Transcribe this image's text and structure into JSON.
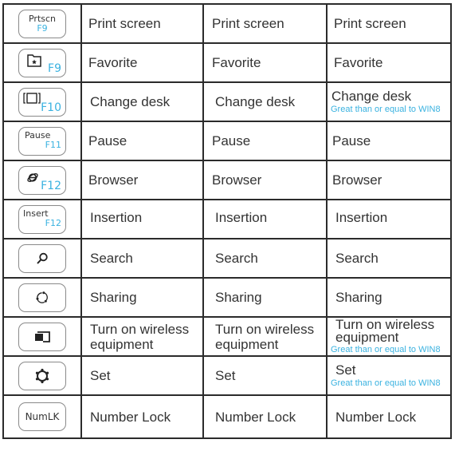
{
  "colors": {
    "border": "#2b2b2b",
    "text": "#333333",
    "fn_blue": "#3ab2e0",
    "note_blue": "#3ab2e0"
  },
  "rows": [
    {
      "key": {
        "top": "Prtscn",
        "fn": "F9",
        "icon": "none"
      },
      "col1": "Print screen",
      "col2": "Print screen",
      "col3": "Print screen",
      "col3_note": ""
    },
    {
      "key": {
        "top": "",
        "fn": "F9",
        "icon": "favorite-folder-star-icon"
      },
      "col1": "Favorite",
      "col2": "Favorite",
      "col3": "Favorite",
      "col3_note": ""
    },
    {
      "key": {
        "top": "",
        "fn": "F10",
        "icon": "change-desk-window-icon"
      },
      "col1": "Change desk",
      "col2": "Change desk",
      "col3": "Change desk",
      "col3_note": "Great than or equal to WIN8"
    },
    {
      "key": {
        "top": "Pause",
        "fn": "F11",
        "icon": "none"
      },
      "col1": "Pause",
      "col2": "Pause",
      "col3": "Pause",
      "col3_note": ""
    },
    {
      "key": {
        "top": "",
        "fn": "F12",
        "icon": "browser-ie-icon"
      },
      "col1": "Browser",
      "col2": "Browser",
      "col3": "Browser",
      "col3_note": ""
    },
    {
      "key": {
        "top": "Insert",
        "fn": "F12",
        "icon": "none"
      },
      "col1": "Insertion",
      "col2": "Insertion",
      "col3": "Insertion",
      "col3_note": ""
    },
    {
      "key": {
        "top": "",
        "fn": "",
        "icon": "search-icon"
      },
      "col1": "Search",
      "col2": "Search",
      "col3": "Search",
      "col3_note": ""
    },
    {
      "key": {
        "top": "",
        "fn": "",
        "icon": "sharing-icon"
      },
      "col1": "Sharing",
      "col2": "Sharing",
      "col3": "Sharing",
      "col3_note": ""
    },
    {
      "key": {
        "top": "",
        "fn": "",
        "icon": "wireless-device-icon"
      },
      "col1": "Turn on wireless equipment",
      "col2": "Turn on wireless equipment",
      "col3": "Turn on wireless equipment",
      "col3_note": "Great than or equal to WIN8"
    },
    {
      "key": {
        "top": "",
        "fn": "",
        "icon": "settings-gear-icon"
      },
      "col1": "Set",
      "col2": "Set",
      "col3": "Set",
      "col3_note": "Great than or equal to WIN8"
    },
    {
      "key": {
        "top": "NumLK",
        "fn": "",
        "icon": "none"
      },
      "col1": "Number Lock",
      "col2": "Number Lock",
      "col3": "Number Lock",
      "col3_note": ""
    }
  ]
}
